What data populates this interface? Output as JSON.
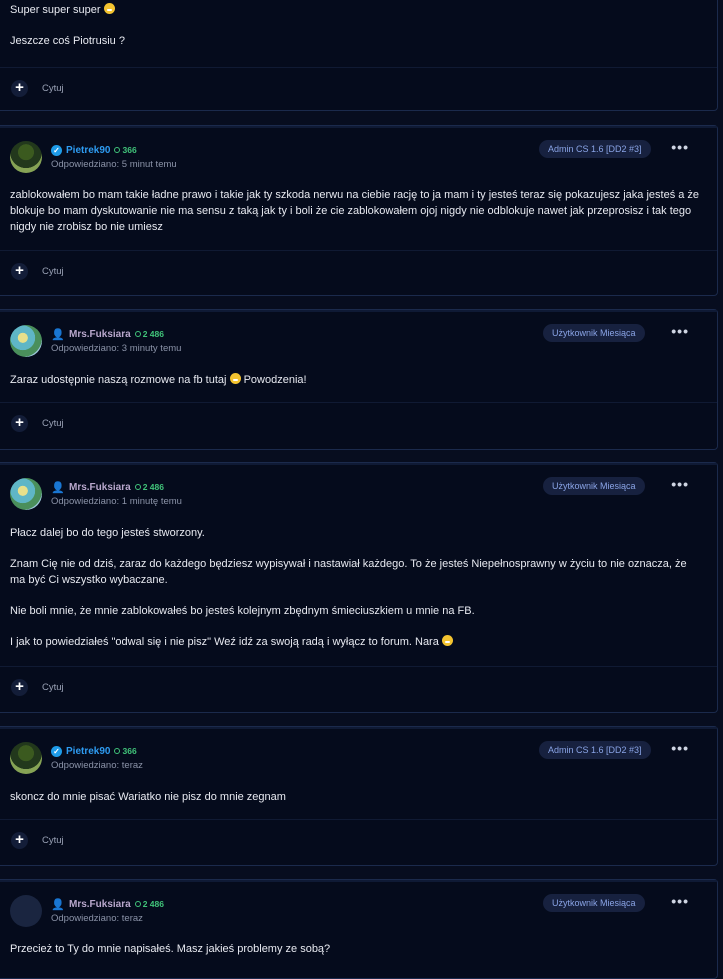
{
  "quote_label": "Cytuj",
  "posts": [
    {
      "paragraphs": [
        "Super super super",
        "Jeszcze coś Piotrusiu ?"
      ]
    },
    {
      "author": "Pietrek90",
      "reputation": "366",
      "time": "Odpowiedziano: 5 minut temu",
      "badge": "Admin CS 1.6 [DD2 #3]",
      "paragraphs": [
        "zablokowałem bo mam takie ładne prawo i takie jak ty szkoda nerwu na ciebie rację to ja mam i ty jesteś  teraz się pokazujesz jaka jesteś  a że blokuje  bo mam  dyskutowanie nie ma sensu z taką jak ty i boli że cie zablokowałem ojoj nigdy nie odblokuje  nawet jak przeprosisz i tak tego nigdy nie zrobisz bo nie umiesz"
      ]
    },
    {
      "author": "Mrs.Fuksiara",
      "reputation": "2 486",
      "time": "Odpowiedziano: 3 minuty temu",
      "badge": "Użytkownik Miesiąca",
      "paragraphs": [
        "Zaraz udostępnie naszą rozmowe na fb tutaj",
        "Powodzenia!"
      ]
    },
    {
      "author": "Mrs.Fuksiara",
      "reputation": "2 486",
      "time": "Odpowiedziano: 1 minutę temu",
      "badge": "Użytkownik Miesiąca",
      "paragraphs": [
        "Płacz dalej bo do tego jesteś stworzony.",
        "Znam Cię nie od dziś, zaraz do każdego będziesz wypisywał i nastawiał każdego. To że jesteś Niepełnosprawny w życiu to nie oznacza, że ma być Ci wszystko wybaczane.",
        "Nie boli mnie, że mnie zablokowałeś bo jesteś kolejnym zbędnym śmieciuszkiem u mnie na FB.",
        "I jak to powiedziałeś \"odwal się i nie pisz\" Weź idź za swoją radą i wyłącz to forum. Nara"
      ]
    },
    {
      "author": "Pietrek90",
      "reputation": "366",
      "time": "Odpowiedziano: teraz",
      "badge": "Admin CS 1.6 [DD2 #3]",
      "paragraphs": [
        "skoncz do mnie pisać Wariatko  nie pisz do mnie zegnam"
      ]
    },
    {
      "author": "Mrs.Fuksiara",
      "reputation": "2 486",
      "time": "Odpowiedziano: teraz",
      "badge": "Użytkownik Miesiąca",
      "paragraphs": [
        "Przecież to Ty do mnie napisałeś. Masz jakieś problemy ze sobą?"
      ]
    }
  ]
}
